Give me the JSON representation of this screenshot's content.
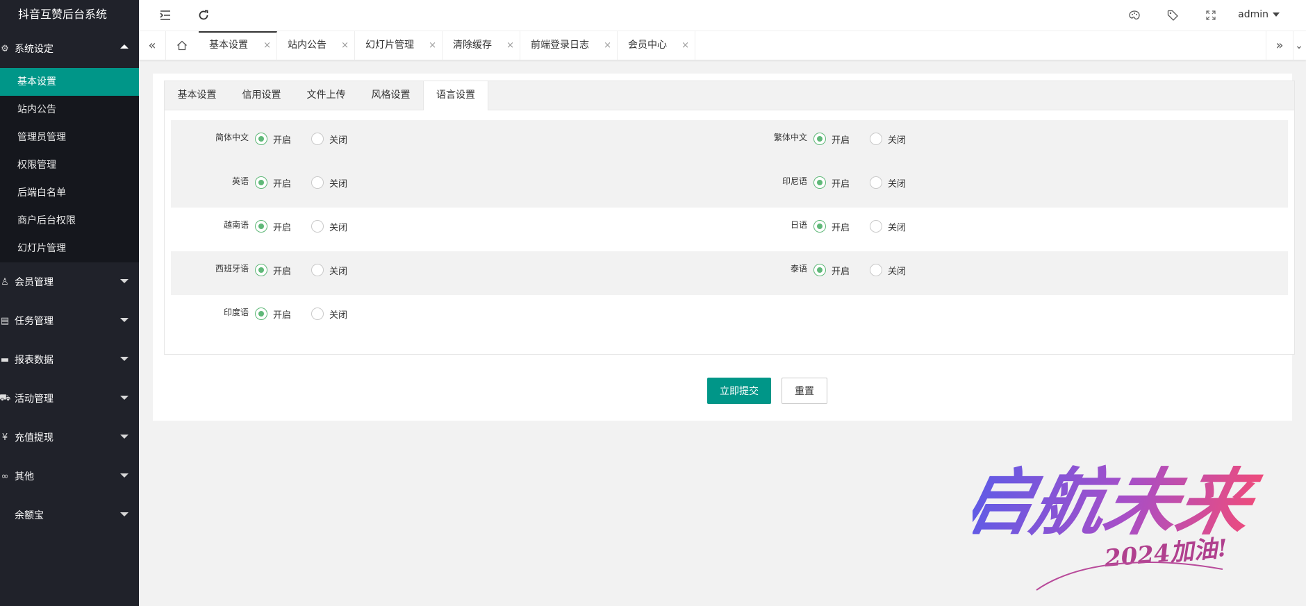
{
  "app": {
    "title": "抖音互赞后台系统"
  },
  "sidebar": {
    "groups": [
      {
        "label": "系统设定",
        "icon": "gear-icon",
        "expanded": true,
        "items": [
          "基本设置",
          "站内公告",
          "管理员管理",
          "权限管理",
          "后端白名单",
          "商户后台权限",
          "幻灯片管理"
        ],
        "active_item": "基本设置"
      },
      {
        "label": "会员管理",
        "icon": "user-icon"
      },
      {
        "label": "任务管理",
        "icon": "document-icon"
      },
      {
        "label": "报表数据",
        "icon": "monitor-icon"
      },
      {
        "label": "活动管理",
        "icon": "car-icon"
      },
      {
        "label": "充值提现",
        "icon": "yen-icon"
      },
      {
        "label": "其他",
        "icon": "link-icon"
      },
      {
        "label": "余额宝",
        "icon": ""
      }
    ]
  },
  "header": {
    "user": "admin",
    "icons": [
      "menu-fold-icon",
      "refresh-icon",
      "theme-icon",
      "tag-icon",
      "fullscreen-icon"
    ]
  },
  "page_tabs": {
    "items": [
      "基本设置",
      "站内公告",
      "幻灯片管理",
      "清除缓存",
      "前端登录日志",
      "会员中心"
    ],
    "active": "基本设置",
    "close_glyph": "×"
  },
  "settings_tabs": {
    "items": [
      "基本设置",
      "信用设置",
      "文件上传",
      "风格设置",
      "语言设置"
    ],
    "active": "语言设置"
  },
  "language_settings": {
    "options": {
      "on": "开启",
      "off": "关闭"
    },
    "rows": [
      [
        {
          "label": "简体中文",
          "value": "on"
        },
        {
          "label": "繁体中文",
          "value": "on"
        }
      ],
      [
        {
          "label": "英语",
          "value": "on"
        },
        {
          "label": "印尼语",
          "value": "on"
        }
      ],
      [
        {
          "label": "越南语",
          "value": "on"
        },
        {
          "label": "日语",
          "value": "on"
        }
      ],
      [
        {
          "label": "西班牙语",
          "value": "on"
        },
        {
          "label": "泰语",
          "value": "on"
        }
      ],
      [
        {
          "label": "印度语",
          "value": "on"
        }
      ]
    ]
  },
  "buttons": {
    "submit": "立即提交",
    "reset": "重置"
  },
  "decoration": {
    "title": "启航未来",
    "subtitle": "2024加油!"
  },
  "colors": {
    "accent": "#009688",
    "radio_on": "#5fb878",
    "sidebar_bg": "#20222a"
  }
}
